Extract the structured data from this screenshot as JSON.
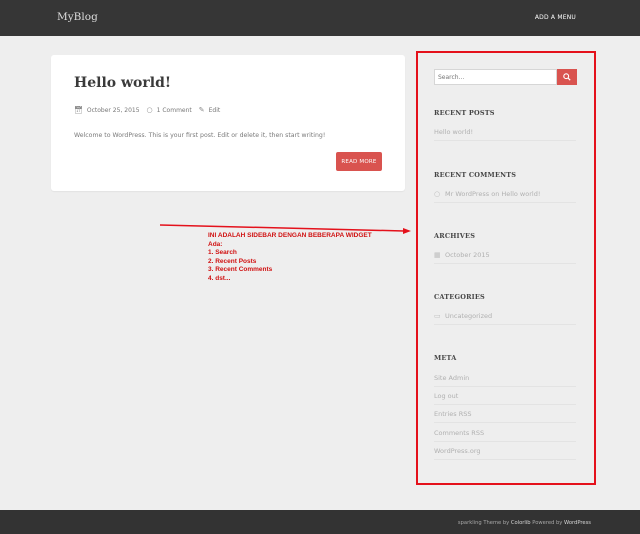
{
  "header": {
    "brand": "MyBlog",
    "menu_label": "ADD A MENU"
  },
  "post": {
    "title": "Hello world!",
    "date": "October 25, 2015",
    "comments": "1 Comment",
    "edit": "Edit",
    "excerpt": "Welcome to WordPress. This is your first post. Edit or delete it, then start writing!",
    "read_more": "READ MORE"
  },
  "annotation": {
    "lines": [
      "INI ADALAH SIDEBAR DENGAN BEBERAPA WIDGET",
      "Ada:",
      "1. Search",
      "2. Recent Posts",
      "3. Recent Comments",
      "4. dst..."
    ],
    "color": "#d01010"
  },
  "sidebar": {
    "search_placeholder": "Search...",
    "recent_posts": {
      "title": "RECENT POSTS",
      "items": [
        "Hello world!"
      ]
    },
    "recent_comments": {
      "title": "RECENT COMMENTS",
      "items": [
        "Mr WordPress on Hello world!"
      ]
    },
    "archives": {
      "title": "ARCHIVES",
      "items": [
        "October 2015"
      ]
    },
    "categories": {
      "title": "CATEGORIES",
      "items": [
        "Uncategorized"
      ]
    },
    "meta": {
      "title": "META",
      "items": [
        "Site Admin",
        "Log out",
        "Entries RSS",
        "Comments RSS",
        "WordPress.org"
      ]
    }
  },
  "footer": {
    "prefix": "sparkling Theme by",
    "theme_author": "Colorlib",
    "middle": "Powered by",
    "platform": "WordPress"
  },
  "colors": {
    "accent": "#d9534f",
    "header_bg": "#363636",
    "frame": "#e4111b"
  }
}
